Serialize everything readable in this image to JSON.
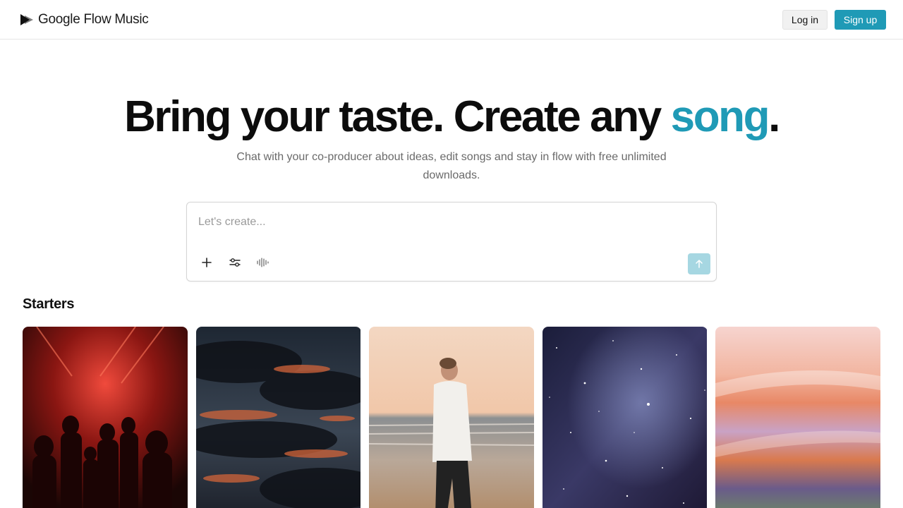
{
  "header": {
    "brand_name": "Google Flow Music",
    "logo_icon": "flow-music-logo-icon",
    "login_label": "Log in",
    "signup_label": "Sign up",
    "accent_color": "#1f9ab6"
  },
  "hero": {
    "title_main": "Bring your taste. Create any ",
    "title_accent": "song",
    "title_end": ".",
    "subtitle": "Chat with your co-producer about ideas, edit songs and stay in flow with free unlimited downloads."
  },
  "composer": {
    "placeholder": "Let's create...",
    "value": "",
    "tools": [
      "plus-icon",
      "sliders-icon",
      "waveform-icon"
    ],
    "send_icon": "arrow-up-icon"
  },
  "starters": {
    "title": "Starters",
    "cards": [
      {
        "name": "starter-card-red-club-crowd"
      },
      {
        "name": "starter-card-sunset-clouds"
      },
      {
        "name": "starter-card-man-on-beach"
      },
      {
        "name": "starter-card-starry-galaxy"
      },
      {
        "name": "starter-card-pastel-gradient"
      }
    ]
  }
}
